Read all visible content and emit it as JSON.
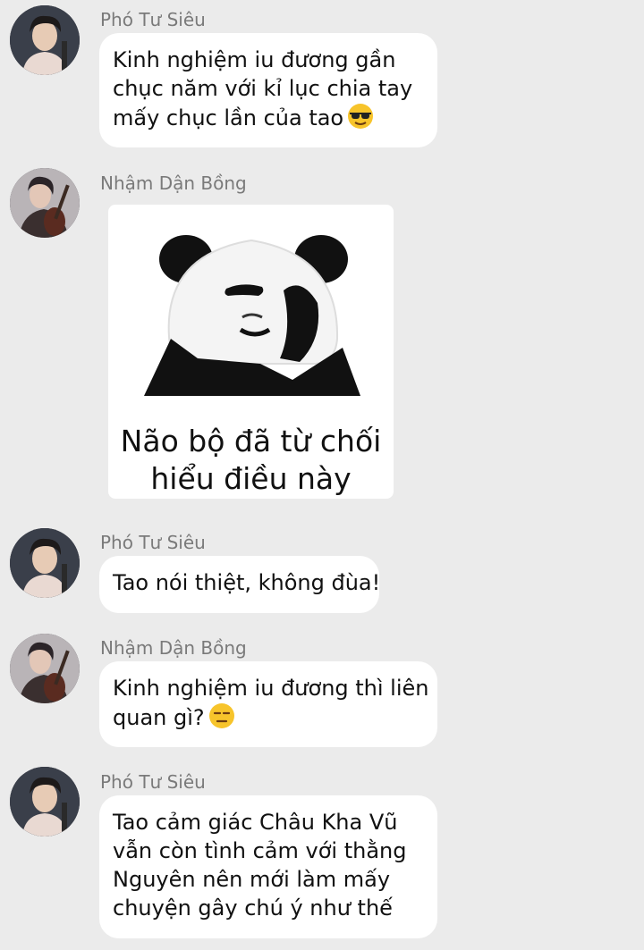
{
  "messages": [
    {
      "sender": "Phó Tư Siêu",
      "avatar": "avatar-pho-tu-sieu",
      "lines": [
        "Kinh nghiệm iu đương gần",
        "chục năm với kỉ lục chia tay",
        "mấy chục lần của tao"
      ],
      "emoji": "sunglasses-emoji"
    },
    {
      "sender": "Nhậm Dận Bồng",
      "avatar": "avatar-nham-dan-bong",
      "sticker": {
        "icon": "panda-meme-sticker",
        "caption": [
          "Não bộ đã từ chối",
          "hiểu điều này"
        ]
      }
    },
    {
      "sender": "Phó Tư Siêu",
      "avatar": "avatar-pho-tu-sieu",
      "lines": [
        "Tao nói thiệt, không đùa!"
      ]
    },
    {
      "sender": "Nhậm Dận Bồng",
      "avatar": "avatar-nham-dan-bong",
      "lines": [
        "Kinh nghiệm iu đương thì liên",
        "quan gì?"
      ],
      "emoji": "expressionless-emoji"
    },
    {
      "sender": "Phó Tư Siêu",
      "avatar": "avatar-pho-tu-sieu",
      "lines": [
        "Tao cảm giác Châu Kha Vũ",
        "vẫn còn tình cảm với thằng",
        "Nguyên nên mới làm mấy",
        "chuyện gây chú ý như thế"
      ]
    }
  ],
  "colors": {
    "background": "#ebebeb",
    "bubble": "#ffffff",
    "sender_text": "#7a7a7a",
    "message_text": "#111111"
  }
}
